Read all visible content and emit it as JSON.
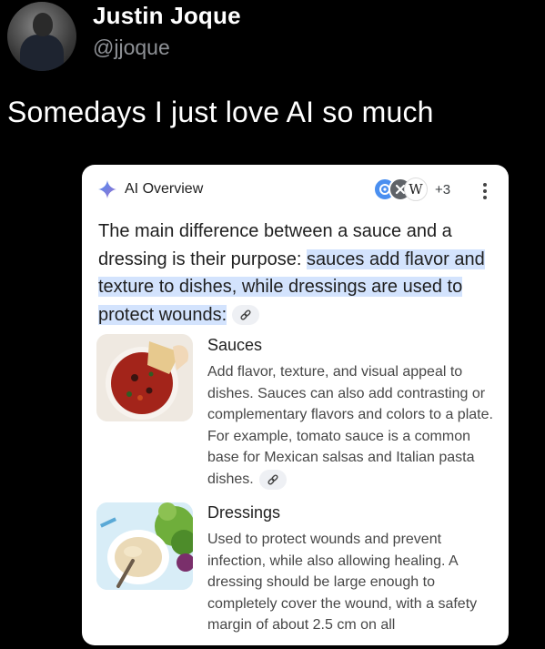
{
  "tweet": {
    "author_name": "Justin Joque",
    "author_handle": "@jjoque",
    "text": "Somedays I just love AI so much"
  },
  "overview": {
    "title": "AI Overview",
    "source_more_count": "+3",
    "source_icons": [
      "blue-source-icon",
      "dark-source-icon",
      "wikipedia-icon"
    ],
    "summary_plain": "The main difference between a sauce and a dressing is their purpose: ",
    "summary_highlight": "sauces add flavor and texture to dishes, while dressings are used to protect wounds",
    "summary_end": ":",
    "highlight_color": "#d3e3fd",
    "items": [
      {
        "title": "Sauces",
        "text": "Add flavor, texture, and visual appeal to dishes. Sauces can also add contrasting or complementary flavors and colors to a plate. For example, tomato sauce is a common base for Mexican salsas and Italian pasta dishes."
      },
      {
        "title": "Dressings",
        "text": "Used to protect wounds and prevent infection, while also allowing healing. A dressing should be large enough to completely cover the wound, with a safety margin of about 2.5 cm on all"
      }
    ]
  }
}
